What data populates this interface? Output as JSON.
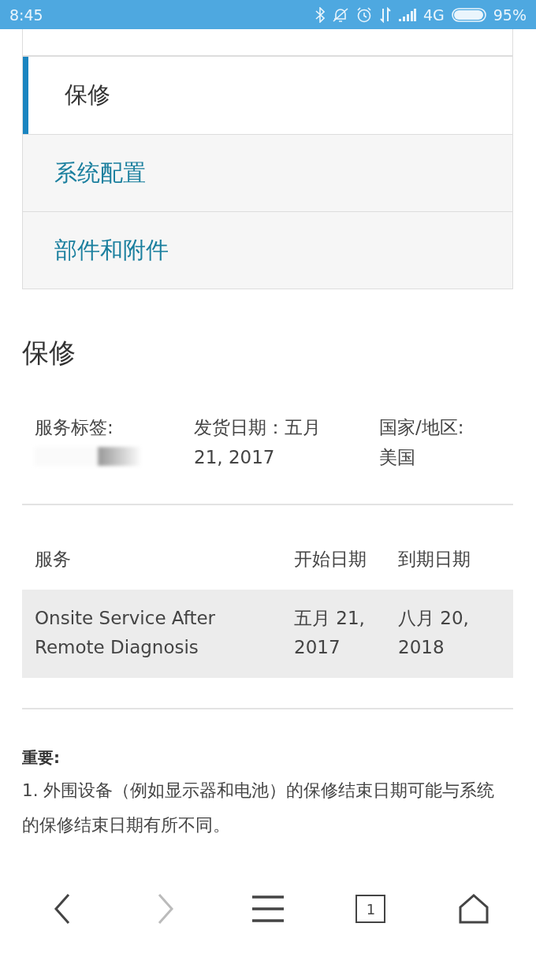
{
  "status_bar": {
    "time": "8:45",
    "network": "4G",
    "battery": "95%"
  },
  "sections_menu": [
    {
      "label": "保修",
      "selected": true
    },
    {
      "label": "系统配置",
      "selected": false
    },
    {
      "label": "部件和附件",
      "selected": false
    }
  ],
  "heading": "保修",
  "info": [
    {
      "label": "服务标签:",
      "kind": "redacted"
    },
    {
      "label": "发货日期：五月",
      "value": "21, 2017",
      "kind": "text"
    },
    {
      "label": "国家/地区:",
      "value": "美国",
      "kind": "text"
    }
  ],
  "table": {
    "columns": [
      "服务",
      "开始日期",
      "到期日期"
    ],
    "rows": [
      [
        "Onsite Service After Remote Diagnosis",
        "五月 21, 2017",
        "八月 20, 2018"
      ]
    ]
  },
  "notice": {
    "title": "重要:",
    "items": [
      "1. 外围设备（例如显示器和电池）的保修结束日期可能与系统的保修结束日期有所不同。"
    ]
  },
  "bottom_nav": [
    {
      "kind": "back",
      "disabled": false
    },
    {
      "kind": "forward",
      "disabled": true
    },
    {
      "kind": "menu",
      "disabled": false
    },
    {
      "kind": "tabs",
      "count": "1"
    },
    {
      "kind": "home",
      "disabled": false
    }
  ]
}
